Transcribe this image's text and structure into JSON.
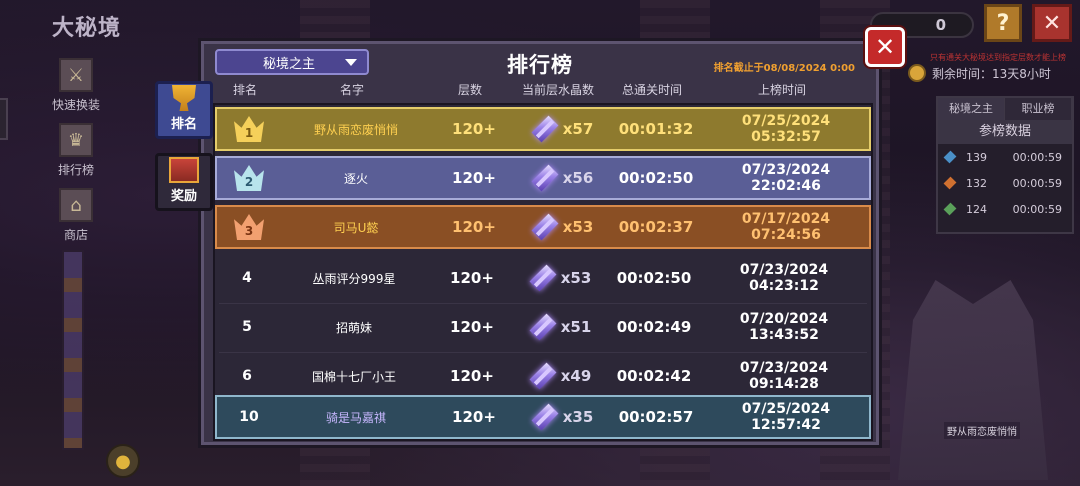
{
  "game": {
    "title": "大秘境",
    "score": "0",
    "help_label": "?",
    "close_label": "✕",
    "remaining_time": "剩余时间：13天8小时",
    "red_notice": "只有通关大秘境达到指定层数才能上榜"
  },
  "left_nav": [
    {
      "label": "快速换装",
      "icon": "armor-icon"
    },
    {
      "label": "排行榜",
      "icon": "trophy-icon"
    },
    {
      "label": "商店",
      "icon": "shop-icon"
    }
  ],
  "right_panel": {
    "tabs": [
      "秘境之主",
      "职业榜"
    ],
    "header": "参榜数据",
    "rows": [
      {
        "value": "139",
        "time": "00:00:59",
        "color": "#4a90c8"
      },
      {
        "value": "132",
        "time": "00:00:59",
        "color": "#d07030"
      },
      {
        "value": "124",
        "time": "00:00:59",
        "color": "#5aa05a"
      }
    ],
    "castle_label": "野从雨恋废悄悄"
  },
  "modal": {
    "title": "排行榜",
    "dropdown": "秘境之主",
    "deadline": "排名截止于08/08/2024 0:00",
    "close": "✕",
    "side_tabs": [
      {
        "label": "排名",
        "icon": "trophy-icon",
        "active": true
      },
      {
        "label": "奖励",
        "icon": "chest-icon",
        "active": false
      }
    ],
    "columns": [
      "排名",
      "名字",
      "层数",
      "当前层水晶数",
      "总通关时间",
      "上榜时间"
    ],
    "rows": [
      {
        "rank": "1",
        "name": "野从雨恋废悄悄",
        "floor": "120+",
        "crystals": "x57",
        "time": "00:01:32",
        "date": "07/25/2024 05:32:57"
      },
      {
        "rank": "2",
        "name": "逐火",
        "floor": "120+",
        "crystals": "x56",
        "time": "00:02:50",
        "date": "07/23/2024 22:02:46"
      },
      {
        "rank": "3",
        "name": "司马U懿",
        "floor": "120+",
        "crystals": "x53",
        "time": "00:02:37",
        "date": "07/17/2024 07:24:56"
      },
      {
        "rank": "4",
        "name": "丛雨评分999星",
        "floor": "120+",
        "crystals": "x53",
        "time": "00:02:50",
        "date": "07/23/2024 04:23:12"
      },
      {
        "rank": "5",
        "name": "招萌妹",
        "floor": "120+",
        "crystals": "x51",
        "time": "00:02:49",
        "date": "07/20/2024 13:43:52"
      },
      {
        "rank": "6",
        "name": "国棉十七厂小王",
        "floor": "120+",
        "crystals": "x49",
        "time": "00:02:42",
        "date": "07/23/2024 09:14:28"
      },
      {
        "rank": "10",
        "name": "骑是马嘉祺",
        "floor": "120+",
        "crystals": "x35",
        "time": "00:02:57",
        "date": "07/25/2024 12:57:42"
      }
    ]
  },
  "colors": {
    "gold_row": "#8e7a2e",
    "silver_row": "#5a5e96",
    "bronze_row": "#8a4f24",
    "self_row": "#2e4a5c",
    "accent_orange": "#f0a030",
    "close_red": "#c42a2a"
  }
}
